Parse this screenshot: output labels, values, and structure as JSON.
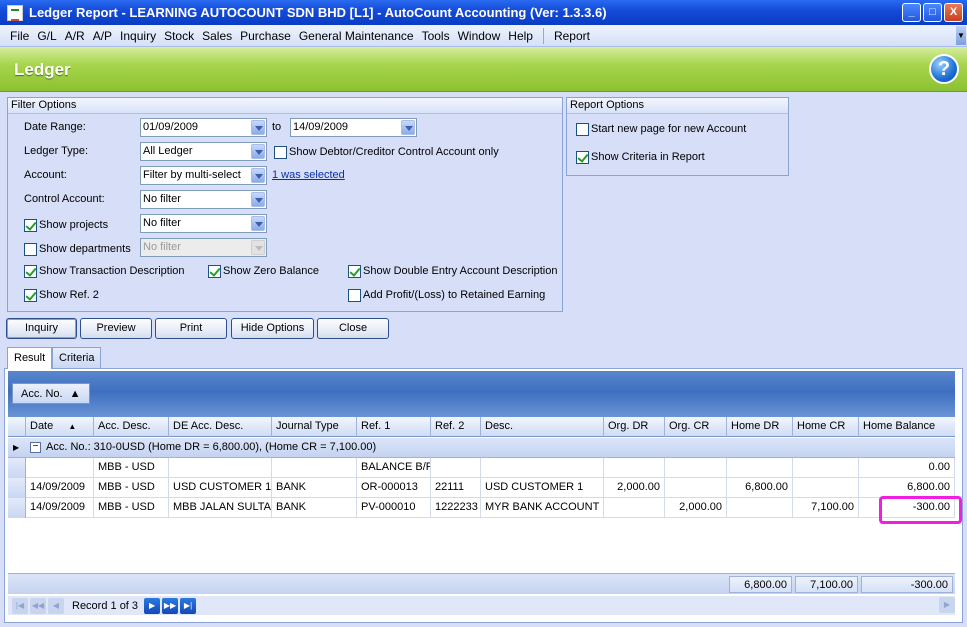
{
  "window": {
    "title": "Ledger Report - LEARNING AUTOCOUNT SDN BHD [L1] - AutoCount Accounting (Ver: 1.3.3.6)",
    "minimize": "_",
    "maximize": "□",
    "close": "X"
  },
  "menu": {
    "items": [
      "File",
      "G/L",
      "A/R",
      "A/P",
      "Inquiry",
      "Stock",
      "Sales",
      "Purchase",
      "General Maintenance",
      "Tools",
      "Window",
      "Help"
    ],
    "report": "Report"
  },
  "header": {
    "title": "Ledger",
    "help": "?"
  },
  "filter": {
    "title": "Filter Options",
    "date_range_label": "Date Range:",
    "date_from": "01/09/2009",
    "to_label": "to",
    "date_to": "14/09/2009",
    "ledger_type_label": "Ledger Type:",
    "ledger_type": "All Ledger",
    "show_control_only": "Show Debtor/Creditor Control Account only",
    "account_label": "Account:",
    "account": "Filter by multi-select",
    "selected_link": "1 was selected",
    "control_account_label": "Control Account:",
    "control_account": "No filter",
    "show_projects": "Show projects",
    "projects": "No filter",
    "show_departments": "Show departments",
    "departments": "No filter",
    "show_trans_desc": "Show Transaction Description",
    "show_zero_balance": "Show Zero Balance",
    "show_double_entry": "Show Double Entry Account Description",
    "show_ref2": "Show Ref. 2",
    "add_profit": "Add Profit/(Loss) to Retained Earning"
  },
  "report_options": {
    "title": "Report Options",
    "new_page": "Start new page for new Account",
    "show_criteria": "Show Criteria in Report"
  },
  "buttons": {
    "inquiry": "Inquiry",
    "preview": "Preview",
    "print": "Print",
    "hide_options": "Hide Options",
    "close": "Close"
  },
  "tabs": {
    "result": "Result",
    "criteria": "Criteria"
  },
  "grid": {
    "group_chip": "Acc. No.",
    "columns": [
      "Date",
      "Acc. Desc.",
      "DE Acc. Desc.",
      "Journal Type",
      "Ref. 1",
      "Ref. 2",
      "Desc.",
      "Org. DR",
      "Org. CR",
      "Home DR",
      "Home CR",
      "Home Balance"
    ],
    "group_row": "Acc. No.: 310-0USD (Home DR = 6,800.00), (Home CR = 7,100.00)",
    "rows": [
      [
        "",
        "MBB - USD",
        "",
        "",
        "BALANCE B/F",
        "",
        "",
        "",
        "",
        "",
        "",
        "0.00"
      ],
      [
        "14/09/2009",
        "MBB - USD",
        "USD CUSTOMER 1",
        "BANK",
        "OR-000013",
        "22111",
        "USD CUSTOMER 1",
        "2,000.00",
        "",
        "6,800.00",
        "",
        "6,800.00"
      ],
      [
        "14/09/2009",
        "MBB - USD",
        "MBB JALAN SULTAN",
        "BANK",
        "PV-000010",
        "1222233",
        "MYR BANK ACCOUNT",
        "",
        "2,000.00",
        "",
        "7,100.00",
        "-300.00"
      ]
    ],
    "totals": {
      "home_dr": "6,800.00",
      "home_cr": "7,100.00",
      "home_balance": "-300.00"
    },
    "record_text": "Record 1 of 3"
  },
  "colors": {
    "accent_green": "#8cc232",
    "title_blue": "#1249d6",
    "highlight": "#f01ee0"
  }
}
